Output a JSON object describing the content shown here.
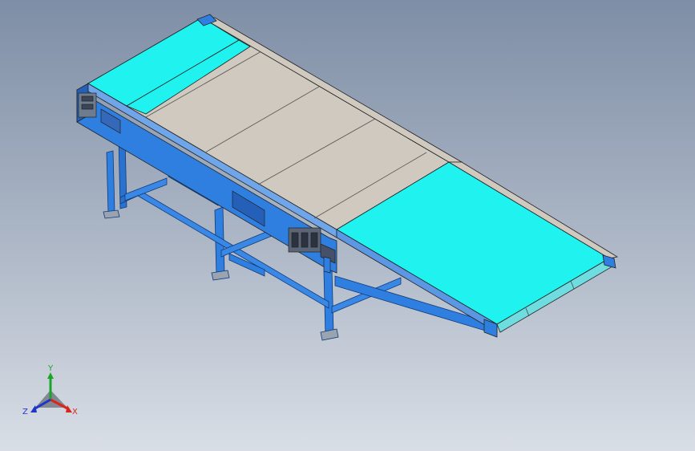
{
  "colors": {
    "background_top": "#7d8da4",
    "background_bottom": "#d7dde6",
    "frame_blue": "#2f7fe0",
    "frame_dark": "#1a4f9c",
    "belt_cyan": "#1ff2ef",
    "cover_beige": "#cfc9bf",
    "outline": "#222"
  },
  "triad": {
    "x_label": "X",
    "y_label": "Y",
    "z_label": "Z",
    "x_color": "#d8261d",
    "y_color": "#1aa52a",
    "z_color": "#2036c8"
  }
}
